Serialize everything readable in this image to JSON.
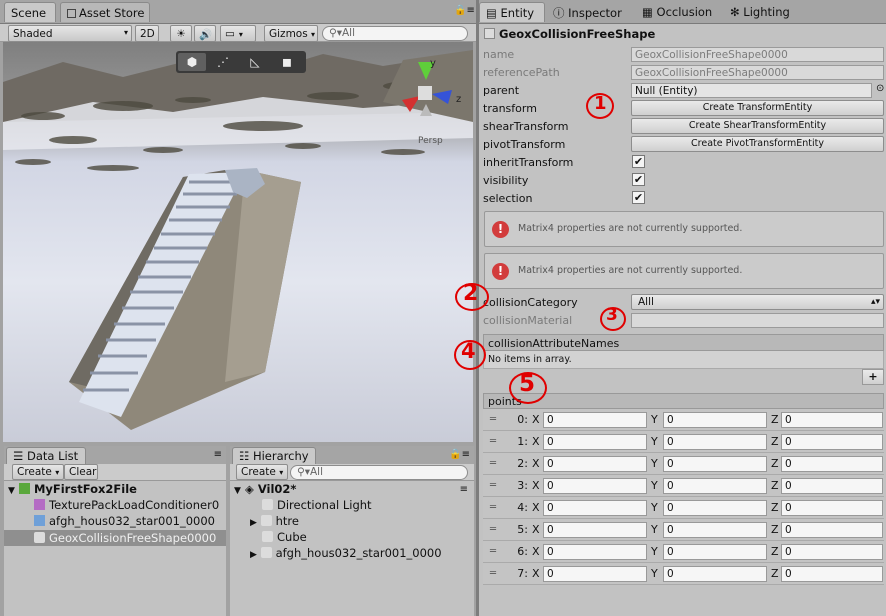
{
  "scene_tabs": {
    "scene": "Scene",
    "asset_store": "Asset Store"
  },
  "scene_toolbar": {
    "shading": "Shaded",
    "mode_2d": "2D",
    "gizmos": "Gizmos",
    "search_placeholder": "All"
  },
  "scene_view": {
    "gizmo_axis_y": "y",
    "gizmo_axis_z": "z",
    "gizmo_label": "Persp"
  },
  "inspector_tabs": {
    "entity": "Entity",
    "inspector": "Inspector",
    "occlusion": "Occlusion",
    "lighting": "Lighting"
  },
  "entity": {
    "title": "GeoxCollisionFreeShape",
    "rows": {
      "name_label": "name",
      "name_value": "GeoxCollisionFreeShape0000",
      "ref_label": "referencePath",
      "ref_value": "GeoxCollisionFreeShape0000",
      "parent_label": "parent",
      "parent_value": "Null (Entity)",
      "transform_label": "transform",
      "transform_button": "Create TransformEntity",
      "shear_label": "shearTransform",
      "shear_button": "Create ShearTransformEntity",
      "pivot_label": "pivotTransform",
      "pivot_button": "Create PivotTransformEntity",
      "inherit_label": "inheritTransform",
      "visibility_label": "visibility",
      "selection_label": "selection",
      "check_mark": "✔"
    },
    "help_text_1": "Matrix4 properties are not currently supported.",
    "help_text_2": "Matrix4 properties are not currently supported.",
    "collision_category_label": "collisionCategory",
    "collision_category_value": "Alll",
    "collision_material_label": "collisionMaterial",
    "attr_names_header": "collisionAttributeNames",
    "empty_array": "No items in array.",
    "add_button": "+",
    "points_header": "points",
    "points": [
      {
        "idx": "0:",
        "x": "0",
        "y": "0",
        "z": "0"
      },
      {
        "idx": "1:",
        "x": "0",
        "y": "0",
        "z": "0"
      },
      {
        "idx": "2:",
        "x": "0",
        "y": "0",
        "z": "0"
      },
      {
        "idx": "3:",
        "x": "0",
        "y": "0",
        "z": "0"
      },
      {
        "idx": "4:",
        "x": "0",
        "y": "0",
        "z": "0"
      },
      {
        "idx": "5:",
        "x": "0",
        "y": "0",
        "z": "0"
      },
      {
        "idx": "6:",
        "x": "0",
        "y": "0",
        "z": "0"
      },
      {
        "idx": "7:",
        "x": "0",
        "y": "0",
        "z": "0"
      }
    ],
    "axis_x": "X",
    "axis_y": "Y",
    "axis_z": "Z"
  },
  "annotations": {
    "a1": "1",
    "a2": "2",
    "a3": "3",
    "a4": "4",
    "a5": "5"
  },
  "data_list": {
    "tab": "Data List",
    "create": "Create",
    "clear": "Clear",
    "root": "MyFirstFox2File",
    "items": [
      "TexturePackLoadConditioner0",
      "afgh_hous032_star001_0000",
      "GeoxCollisionFreeShape0000"
    ]
  },
  "hierarchy": {
    "tab": "Hierarchy",
    "create": "Create",
    "search_placeholder": "All",
    "scene": "Vil02*",
    "items": [
      "Directional Light",
      "htre",
      "Cube",
      "afgh_hous032_star001_0000"
    ]
  },
  "colors": {
    "accent_red": "#e00000",
    "selection": "#8f8f8f",
    "scene_sky": "#8e8e8e"
  }
}
